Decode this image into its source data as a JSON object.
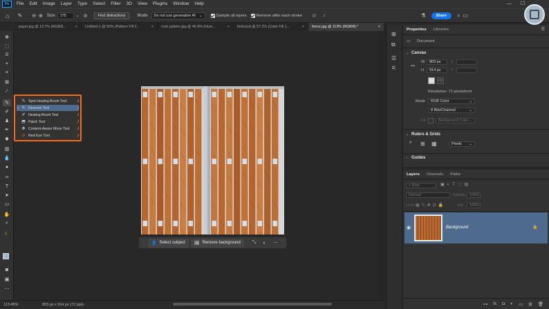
{
  "app": {
    "logo": "Ps"
  },
  "menu": [
    "File",
    "Edit",
    "Image",
    "Layer",
    "Type",
    "Select",
    "Filter",
    "3D",
    "View",
    "Plugins",
    "Window",
    "Help"
  ],
  "options": {
    "size_label": "Size",
    "size_value": "175",
    "find_distractions": "Find distractions",
    "mode_label": "Mode",
    "mode_value": "Do not use generative AI",
    "sample_all_layers": "Sample all layers",
    "remove_after_stroke": "Remove after each stroke",
    "share": "Share"
  },
  "tabs": [
    {
      "label": "paper.jpg @ 13.7% (RGB/8...",
      "close": "×"
    },
    {
      "label": "Untitled-1 @ 50% (Pattern Fill 2...",
      "close": "×"
    },
    {
      "label": "rock pattern.jpg @ 46.9% (Hue/...",
      "close": "×"
    },
    {
      "label": "field.psd @ 57.2% (Color Fill 1...",
      "close": "×"
    },
    {
      "label": "fence.jpg @ 113% (RGB/8) *",
      "close": "×"
    }
  ],
  "flyout": [
    {
      "icon": "spot-healing-brush-icon",
      "label": "Spot Healing Brush Tool",
      "shortcut": "J",
      "selected": false
    },
    {
      "icon": "remove-tool-icon",
      "label": "Remove Tool",
      "shortcut": "J",
      "selected": true
    },
    {
      "icon": "healing-brush-icon",
      "label": "Healing Brush Tool",
      "shortcut": "J",
      "selected": false
    },
    {
      "icon": "patch-tool-icon",
      "label": "Patch Tool",
      "shortcut": "J",
      "selected": false
    },
    {
      "icon": "content-aware-move-icon",
      "label": "Content-Aware Move Tool",
      "shortcut": "J",
      "selected": false
    },
    {
      "icon": "red-eye-icon",
      "label": "Red Eye Tool",
      "shortcut": "J",
      "selected": false
    }
  ],
  "contextbar": {
    "select_subject": "Select subject",
    "remove_background": "Remove background"
  },
  "status": {
    "zoom": "113.45%",
    "doc_size": "803 px x 914 px (72 ppi)"
  },
  "panel": {
    "tabs": [
      "Properties",
      "Libraries"
    ],
    "doc_label": "Document",
    "canvas": {
      "title": "Canvas",
      "w_label": "W",
      "w_value": "803 px",
      "x_label": "X",
      "h_label": "H",
      "h_value": "914 px",
      "y_label": "Y",
      "resolution": "Resolution: 72 pixels/inch",
      "mode_label": "Mode",
      "mode_value": "RGB Color",
      "depth_value": "8 Bits/Channel",
      "fill_label": "Fill",
      "fill_value": "Background Color"
    },
    "rulers": {
      "title": "Rulers & Grids",
      "units": "Pixels"
    },
    "guides": {
      "title": "Guides"
    }
  },
  "layers_panel": {
    "tabs": [
      "Layers",
      "Channels",
      "Paths"
    ],
    "kind_label": "Kind",
    "blend": "Normal",
    "opacity_label": "Opacity:",
    "opacity_value": "100%",
    "lock_label": "Lock:",
    "fill_label": "Fill:",
    "fill_value": "100%",
    "layer_name": "Background"
  },
  "colors": {
    "accent": "#1473e6",
    "highlight": "#ff6a14",
    "selection": "#4e6a8c"
  }
}
